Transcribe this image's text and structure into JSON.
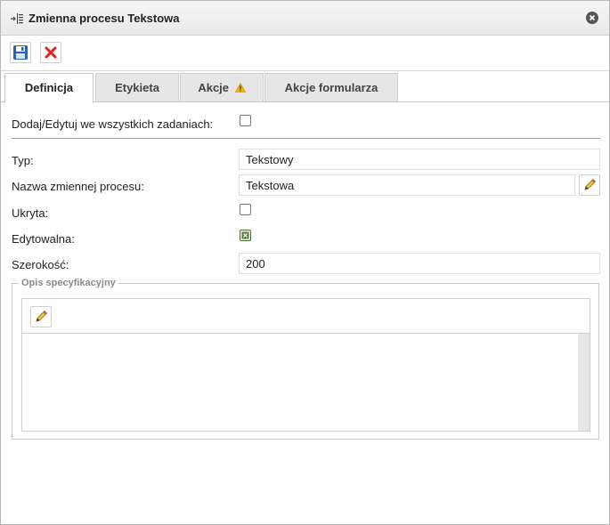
{
  "window": {
    "title": "Zmienna procesu Tekstowa"
  },
  "tabs": [
    {
      "label": "Definicja",
      "active": true
    },
    {
      "label": "Etykieta",
      "active": false
    },
    {
      "label": "Akcje",
      "active": false,
      "warning": true
    },
    {
      "label": "Akcje formularza",
      "active": false
    }
  ],
  "form": {
    "add_edit_all_label": "Dodaj/Edytuj we wszystkich zadaniach:",
    "add_edit_all_checked": false,
    "type_label": "Typ:",
    "type_value": "Tekstowy",
    "var_name_label": "Nazwa zmiennej procesu:",
    "var_name_value": "Tekstowa",
    "hidden_label": "Ukryta:",
    "hidden_checked": false,
    "editable_label": "Edytowalna:",
    "editable_checked": true,
    "width_label": "Szerokość:",
    "width_value": "200"
  },
  "spec": {
    "legend": "Opis specyfikacyjny",
    "content": ""
  },
  "colors": {
    "accent_divider": "#8aa2bf",
    "save_icon": "#2a64b8",
    "close_icon": "#e02020",
    "warning": "#f0b400"
  },
  "icons": [
    "panel-icon",
    "close-icon",
    "save-icon",
    "delete-icon",
    "warning-icon",
    "pencil-icon",
    "checkbox-checked-icon"
  ]
}
